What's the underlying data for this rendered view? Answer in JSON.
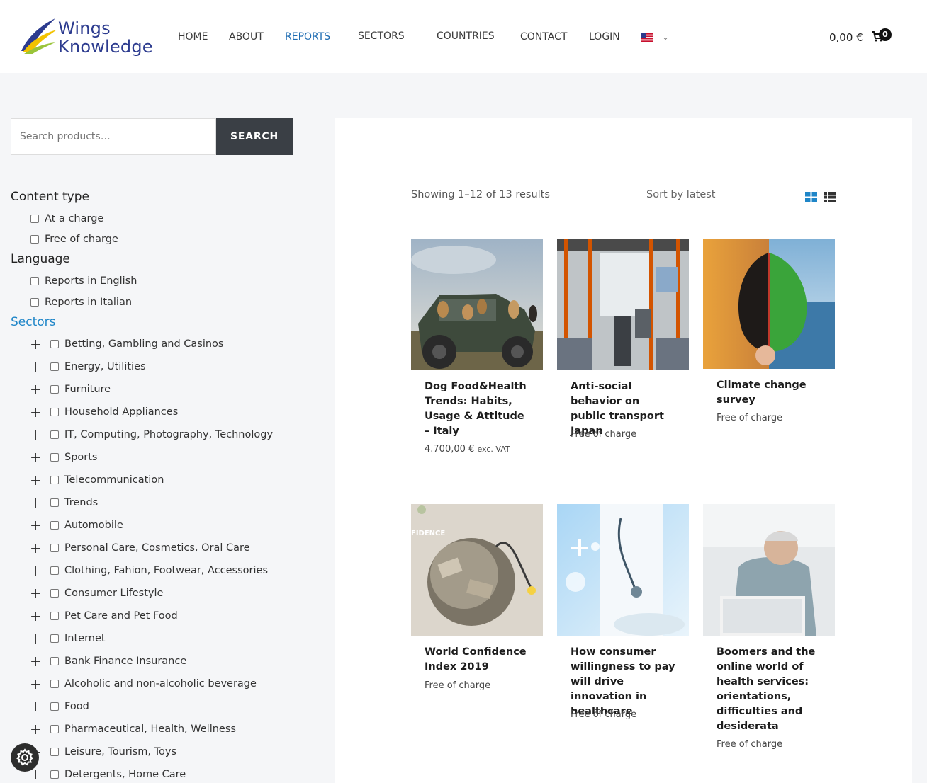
{
  "brand": {
    "line1": "Wings",
    "line2": "Knowledge"
  },
  "nav": [
    {
      "label": "HOME",
      "active": false
    },
    {
      "label": "ABOUT",
      "active": false
    },
    {
      "label": "REPORTS",
      "active": true
    },
    {
      "label": "SECTORS",
      "active": false
    },
    {
      "label": "COUNTRIES",
      "active": false
    },
    {
      "label": "CONTACT",
      "active": false
    },
    {
      "label": "LOGIN",
      "active": false
    }
  ],
  "cart": {
    "total": "0,00 €",
    "count": "0"
  },
  "search": {
    "placeholder": "Search products…",
    "button": "SEARCH"
  },
  "filters": {
    "content_type": {
      "title": "Content type",
      "options": [
        "At a charge",
        "Free of charge"
      ]
    },
    "language": {
      "title": "Language",
      "options": [
        "Reports in English",
        "Reports in Italian"
      ]
    },
    "sectors": {
      "title": "Sectors",
      "options": [
        "Betting, Gambling and Casinos",
        "Energy, Utilities",
        "Furniture",
        "Household Appliances",
        "IT, Computing, Photography, Technology",
        "Sports",
        "Telecommunication",
        "Trends",
        "Automobile",
        "Personal Care, Cosmetics, Oral Care",
        "Clothing, Fahion, Footwear, Accessories",
        "Consumer Lifestyle",
        "Pet Care and Pet Food",
        "Internet",
        "Bank Finance Insurance",
        "Alcoholic and non-alcoholic beverage",
        "Food",
        "Pharmaceutical, Health, Wellness",
        "Leisure, Tourism, Toys",
        "Detergents, Home Care"
      ]
    }
  },
  "results": {
    "showing": "Showing 1–12 of 13 results",
    "sort": "Sort by latest"
  },
  "products": [
    {
      "title": "Dog Food&Health Trends: Habits, Usage & Attitude – Italy",
      "price": "4.700,00 €",
      "vat": "exc. VAT"
    },
    {
      "title": "Anti-social behavior on public transport Japan",
      "price": "Free of charge",
      "vat": ""
    },
    {
      "title": "Climate change survey",
      "price": "Free of charge",
      "vat": ""
    },
    {
      "title": "World Confidence Index 2019",
      "price": "Free of charge",
      "vat": "",
      "image_text": "FIDENCE"
    },
    {
      "title": "How consumer willingness to pay will drive innovation in healthcare",
      "price": "Free of charge",
      "vat": ""
    },
    {
      "title": "Boomers and the online world of health services: orientations, difficulties and desiderata",
      "price": "Free of charge",
      "vat": ""
    }
  ],
  "colors": {
    "accent": "#1f6db3",
    "sectors_title": "#1f86c8",
    "search_button": "#3a3f45"
  }
}
